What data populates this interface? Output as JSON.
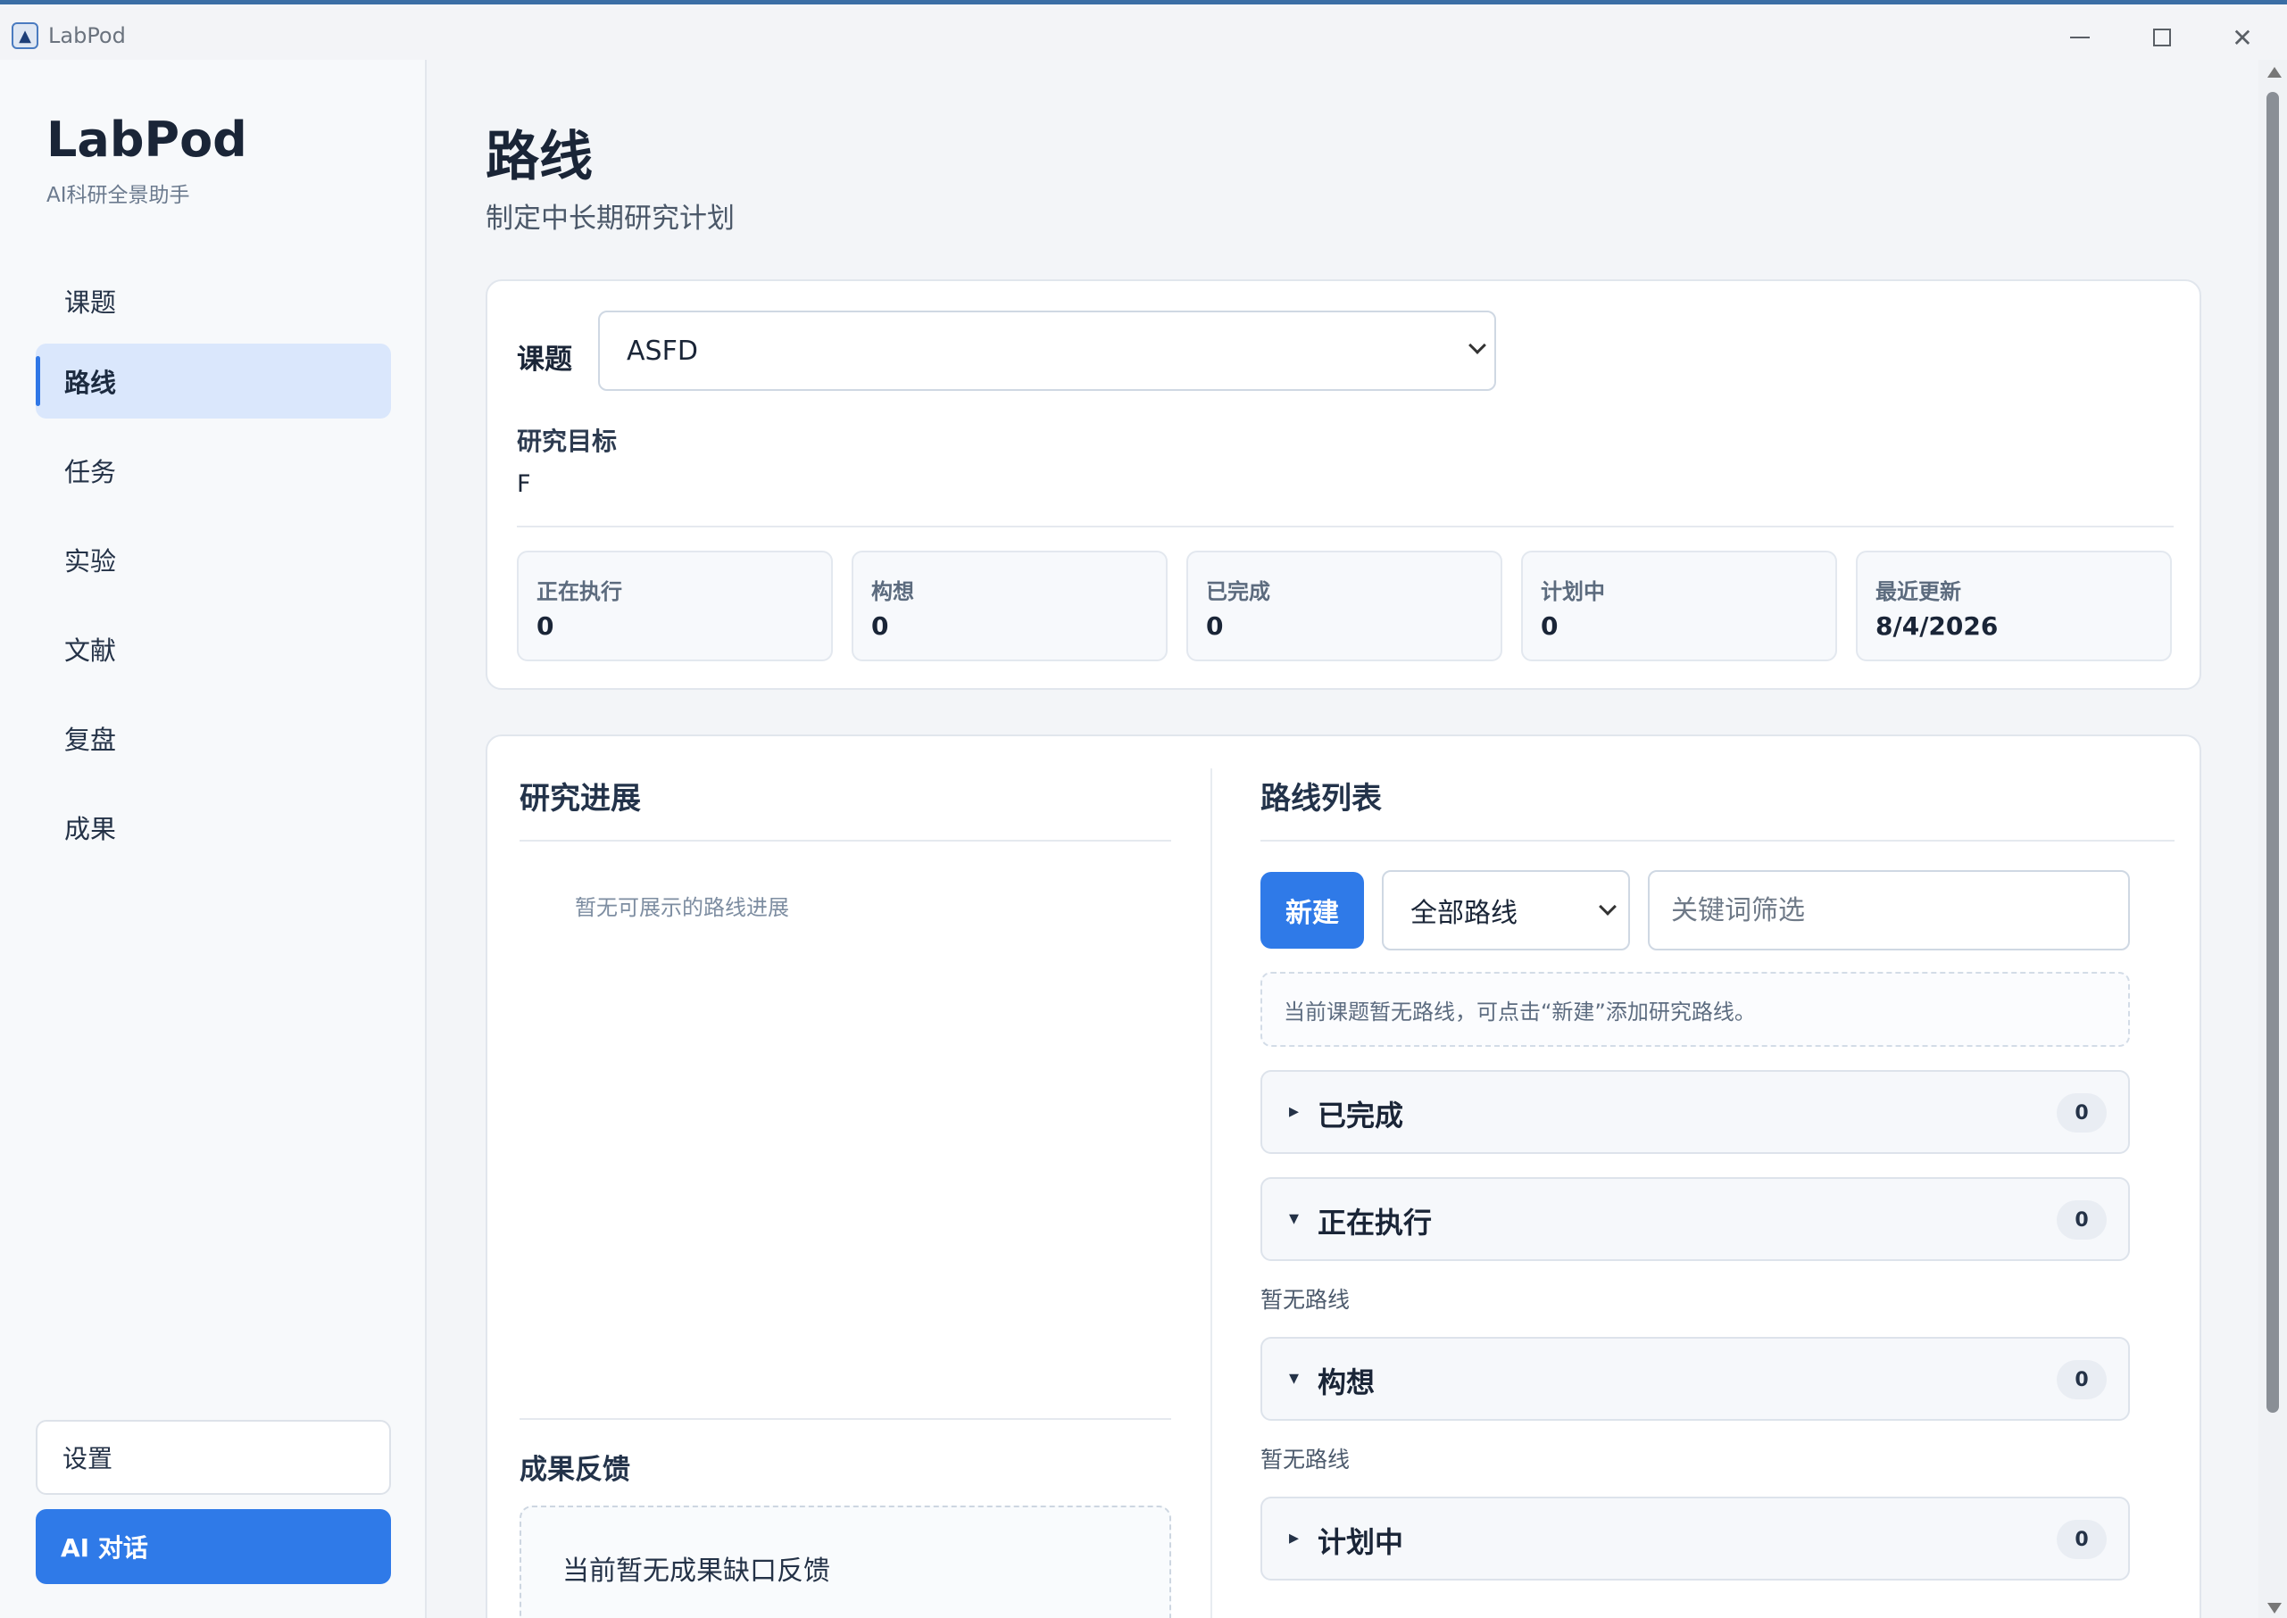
{
  "window": {
    "title": "LabPod",
    "icon": "app-logo-icon"
  },
  "sidebar": {
    "brand": "LabPod",
    "brand_sub": "AI科研全景助手",
    "items": [
      {
        "label": "课题",
        "active": false
      },
      {
        "label": "路线",
        "active": true
      },
      {
        "label": "任务",
        "active": false
      },
      {
        "label": "实验",
        "active": false
      },
      {
        "label": "文献",
        "active": false
      },
      {
        "label": "复盘",
        "active": false
      },
      {
        "label": "成果",
        "active": false
      }
    ],
    "settings_label": "设置",
    "ai_label": "AI 对话"
  },
  "header": {
    "title": "路线",
    "subtitle": "制定中长期研究计划"
  },
  "topic_card": {
    "topic_label": "课题",
    "topic_value": "ASFD",
    "goal_label": "研究目标",
    "goal_value": "F",
    "stats": [
      {
        "label": "正在执行",
        "value": "0"
      },
      {
        "label": "构想",
        "value": "0"
      },
      {
        "label": "已完成",
        "value": "0"
      },
      {
        "label": "计划中",
        "value": "0"
      },
      {
        "label": "最近更新",
        "value": "8/4/2026"
      }
    ]
  },
  "progress": {
    "title": "研究进展",
    "empty_text": "暂无可展示的路线进展",
    "feedback_title": "成果反馈",
    "feedback_empty": "当前暂无成果缺口反馈"
  },
  "routes": {
    "title": "路线列表",
    "new_label": "新建",
    "filter_value": "全部路线",
    "keyword_placeholder": "关键词筛选",
    "notice": "当前课题暂无路线，可点击“新建”添加研究路线。",
    "empty_label": "暂无路线",
    "groups": [
      {
        "label": "已完成",
        "count": "0",
        "arrow": "▸",
        "expanded": false
      },
      {
        "label": "正在执行",
        "count": "0",
        "arrow": "▾",
        "expanded": true
      },
      {
        "label": "构想",
        "count": "0",
        "arrow": "▾",
        "expanded": true
      },
      {
        "label": "计划中",
        "count": "0",
        "arrow": "▸",
        "expanded": false
      }
    ]
  },
  "colors": {
    "accent": "#2f7ae8",
    "active_nav_bg": "#dae7fc",
    "text_primary": "#1a2537"
  }
}
